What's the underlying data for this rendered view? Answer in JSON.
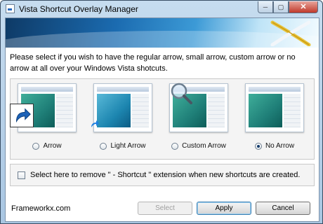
{
  "window": {
    "title": "Vista Shortcut Overlay Manager",
    "caption": {
      "minimize": "─",
      "maximize": "▢",
      "close": "✕"
    }
  },
  "instructions": "Please select if you wish to have the regular arrow, small arrow, custom arrow or no arrow at all over your Windows Vista shotcuts.",
  "options": [
    {
      "label": "Arrow",
      "selected": false
    },
    {
      "label": "Light Arrow",
      "selected": false
    },
    {
      "label": "Custom Arrow",
      "selected": false
    },
    {
      "label": "No Arrow",
      "selected": true
    }
  ],
  "checkbox": {
    "label": "Select here to remove \" - Shortcut \" extension when new shortcuts are created.",
    "checked": false
  },
  "footer": {
    "brand": "Frameworkx.com",
    "select_label": "Select",
    "apply_label": "Apply",
    "cancel_label": "Cancel"
  },
  "colors": {
    "accent": "#1b6bb0",
    "frame": "#a9c6e2"
  }
}
